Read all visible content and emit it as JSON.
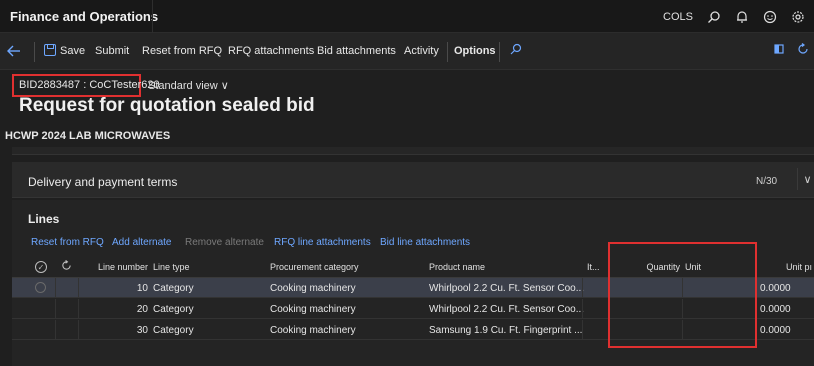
{
  "topbar": {
    "app_title": "Finance and Operations",
    "company": "COLS",
    "icons": [
      "search-icon",
      "bell-icon",
      "smiley-icon",
      "gear-icon"
    ]
  },
  "actionbar": {
    "save_label": "Save",
    "submit_label": "Submit",
    "reset_label": "Reset from RFQ",
    "rfq_attachments_label": "RFQ attachments",
    "bid_attachments_label": "Bid attachments",
    "activity_label": "Activity",
    "options_label": "Options"
  },
  "header": {
    "record_id": "BID2883487 : CoCTester620",
    "view_label": "Standard view ∨",
    "title": "Request for quotation sealed bid",
    "subtitle": "HCWP 2024 LAB MICROWAVES"
  },
  "delivery": {
    "title": "Delivery and payment terms",
    "count": "N/30",
    "chevron": "∨"
  },
  "lines": {
    "title": "Lines",
    "toolbar": {
      "reset": "Reset from RFQ",
      "add_alternate": "Add alternate",
      "remove_alternate": "Remove alternate",
      "rfq_line_attachments": "RFQ line attachments",
      "bid_line_attachments": "Bid line attachments"
    },
    "columns": {
      "line_number": "Line number",
      "line_type": "Line type",
      "procurement_category": "Procurement category",
      "product_name": "Product name",
      "item": "It...",
      "quantity": "Quantity",
      "unit": "Unit",
      "unit_price": "Unit pı"
    },
    "rows": [
      {
        "line_number": "10",
        "line_type": "Category",
        "procurement_category": "Cooking machinery",
        "product_name": "Whirlpool 2.2 Cu. Ft. Sensor Coo...",
        "item": "",
        "quantity": "",
        "unit": "",
        "unit_price": "0.0000"
      },
      {
        "line_number": "20",
        "line_type": "Category",
        "procurement_category": "Cooking machinery",
        "product_name": "Whirlpool 2.2 Cu. Ft. Sensor Coo...",
        "item": "",
        "quantity": "",
        "unit": "",
        "unit_price": "0.0000"
      },
      {
        "line_number": "30",
        "line_type": "Category",
        "procurement_category": "Cooking machinery",
        "product_name": "Samsung 1.9 Cu. Ft. Fingerprint ...",
        "item": "",
        "quantity": "",
        "unit": "",
        "unit_price": "0.0000"
      }
    ]
  },
  "colors": {
    "accent": "#6ea7ff",
    "highlight": "#e03030",
    "background": "#1f1f1f"
  }
}
